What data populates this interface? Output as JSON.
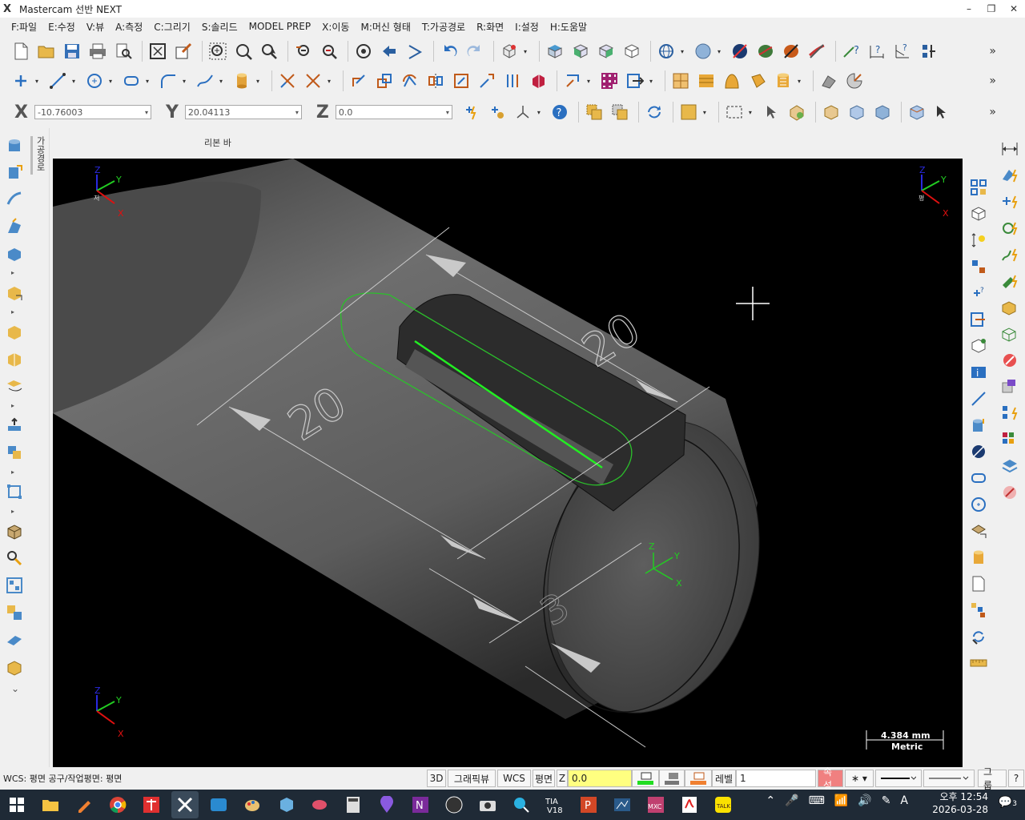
{
  "window": {
    "title": "Mastercam 선반 NEXT",
    "icon": "mastercam-x-logo",
    "minimize": "–",
    "restore": "❐",
    "close": "✕"
  },
  "menu": [
    "F:파일",
    "E:수정",
    "V:뷰",
    "A:측정",
    "C:그리기",
    "S:솔리드",
    "MODEL PREP",
    "X:이동",
    "M:머신 형태",
    "T:가공경로",
    "R:화면",
    "I:설정",
    "H:도움말"
  ],
  "coords": {
    "x_label": "X",
    "x_value": "-10.76003",
    "y_label": "Y",
    "y_value": "20.04113",
    "z_label": "Z",
    "z_value": "0.0"
  },
  "panel": {
    "ops_tab": "가공경로",
    "ribbon_label": "리본 바"
  },
  "viewport": {
    "background": "#000000",
    "dimensions": {
      "d1": "20",
      "d2": "20",
      "d3": "3"
    },
    "scale_value": "4.384 mm",
    "scale_unit": "Metric",
    "gnomon": {
      "z": "Z",
      "y": "Y",
      "x": "X",
      "origin_tl": "저",
      "origin_tr": "평"
    }
  },
  "status": {
    "wcs_text": "WCS: 평면  공구/작업평면: 평면",
    "btn_3d": "3D",
    "btn_graphicview": "그래픽뷰",
    "btn_wcs": "WCS",
    "btn_plane": "평면",
    "z_label": "Z",
    "z_value": "0.0",
    "level_label": "레벨",
    "level_value": "1",
    "attr": "속성",
    "group": "그룹",
    "help": "?"
  },
  "taskbar": {
    "time": "오후 12:54",
    "date": "2026-03-28",
    "notif_count": "3",
    "ime": "A"
  },
  "colors": {
    "accent_green": "#22dd22",
    "dim_line": "#cfcfcf",
    "blue_axis": "#2a2adf",
    "red_axis": "#e01010"
  }
}
